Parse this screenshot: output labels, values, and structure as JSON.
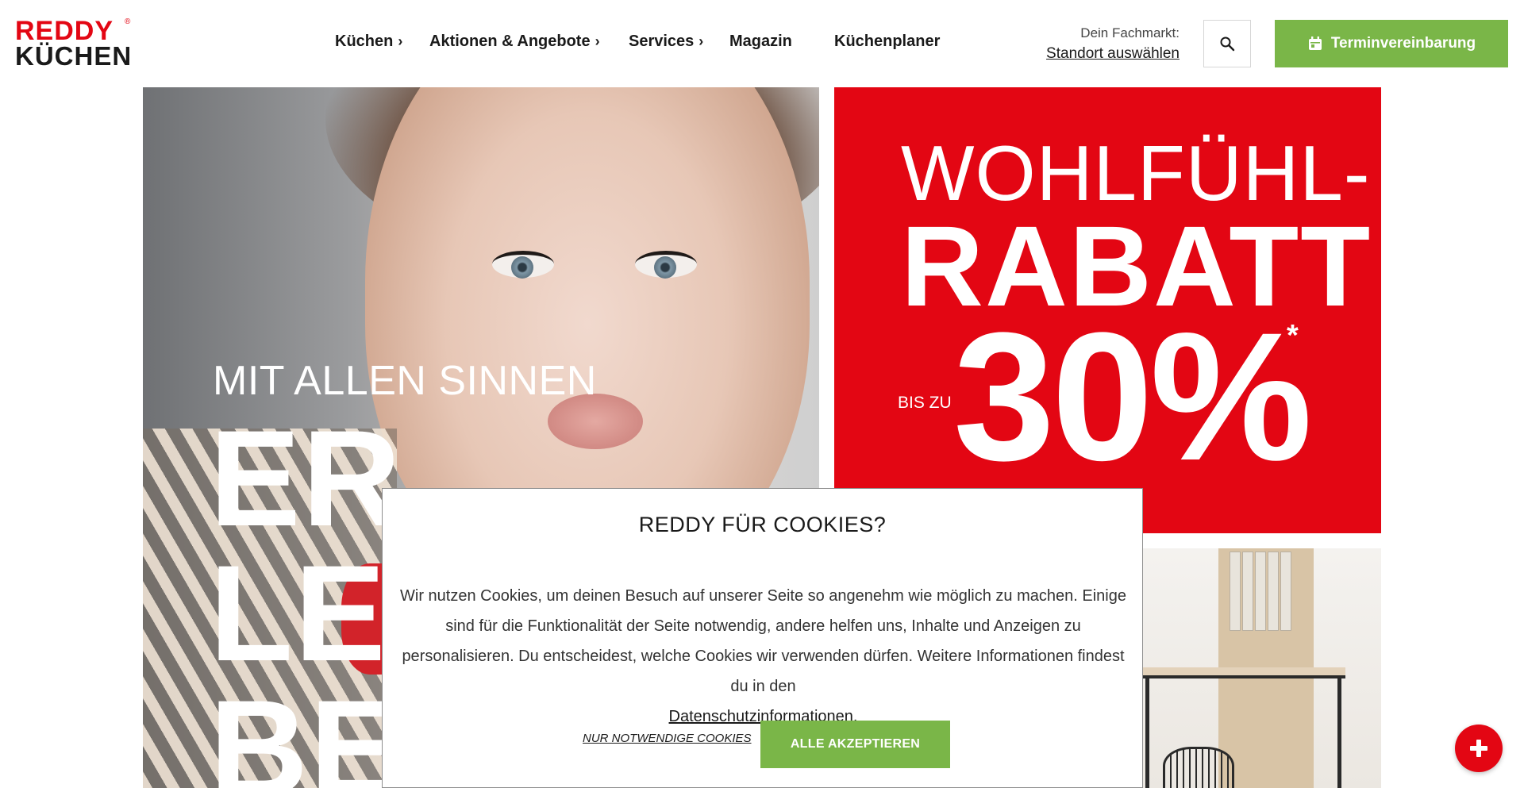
{
  "brand": {
    "line1": "REDDY",
    "line2": "KÜCHEN",
    "registered": "®"
  },
  "nav": {
    "items": [
      {
        "label": "Küchen",
        "chevron": "›"
      },
      {
        "label": "Aktionen & Angebote",
        "chevron": "›"
      },
      {
        "label": "Services",
        "chevron": "›"
      },
      {
        "label": "Magazin",
        "chevron": ""
      },
      {
        "label": "Küchenplaner",
        "chevron": ""
      }
    ]
  },
  "fachmarkt": {
    "label": "Dein Fachmarkt:",
    "link": "Standort auswählen"
  },
  "search": {
    "icon": "search-icon"
  },
  "appointment": {
    "icon": "calendar-icon",
    "label": "Terminvereinbarung"
  },
  "hero_left": {
    "tagline": "MIT ALLEN SINNEN",
    "big": [
      "ER",
      "LE",
      "BE"
    ]
  },
  "hero_right": {
    "line1": "WOHLFÜHL-",
    "line2": "RABATT",
    "prefix": "BIS ZU",
    "value": "30%",
    "asterisk": "*"
  },
  "cookie": {
    "title": "REDDY FÜR COOKIES?",
    "text": "Wir nutzen Cookies, um deinen Besuch auf unserer Seite so angenehm wie möglich zu machen. Einige sind für die Funktionalität der Seite notwendig, andere helfen uns, Inhalte und Anzeigen zu personalisieren. Du entscheidest, welche Cookies wir verwenden dürfen. Weitere Informationen findest du in den",
    "link": "Datenschutzinformationen",
    "link_suffix": ".",
    "necessary_label": "NUR NOTWENDIGE COOKIES",
    "accept_label": "ALLE AKZEPTIEREN"
  },
  "fab": {
    "icon": "plus-icon"
  },
  "colors": {
    "brand_red": "#e30613",
    "accent_green": "#7ab648"
  }
}
